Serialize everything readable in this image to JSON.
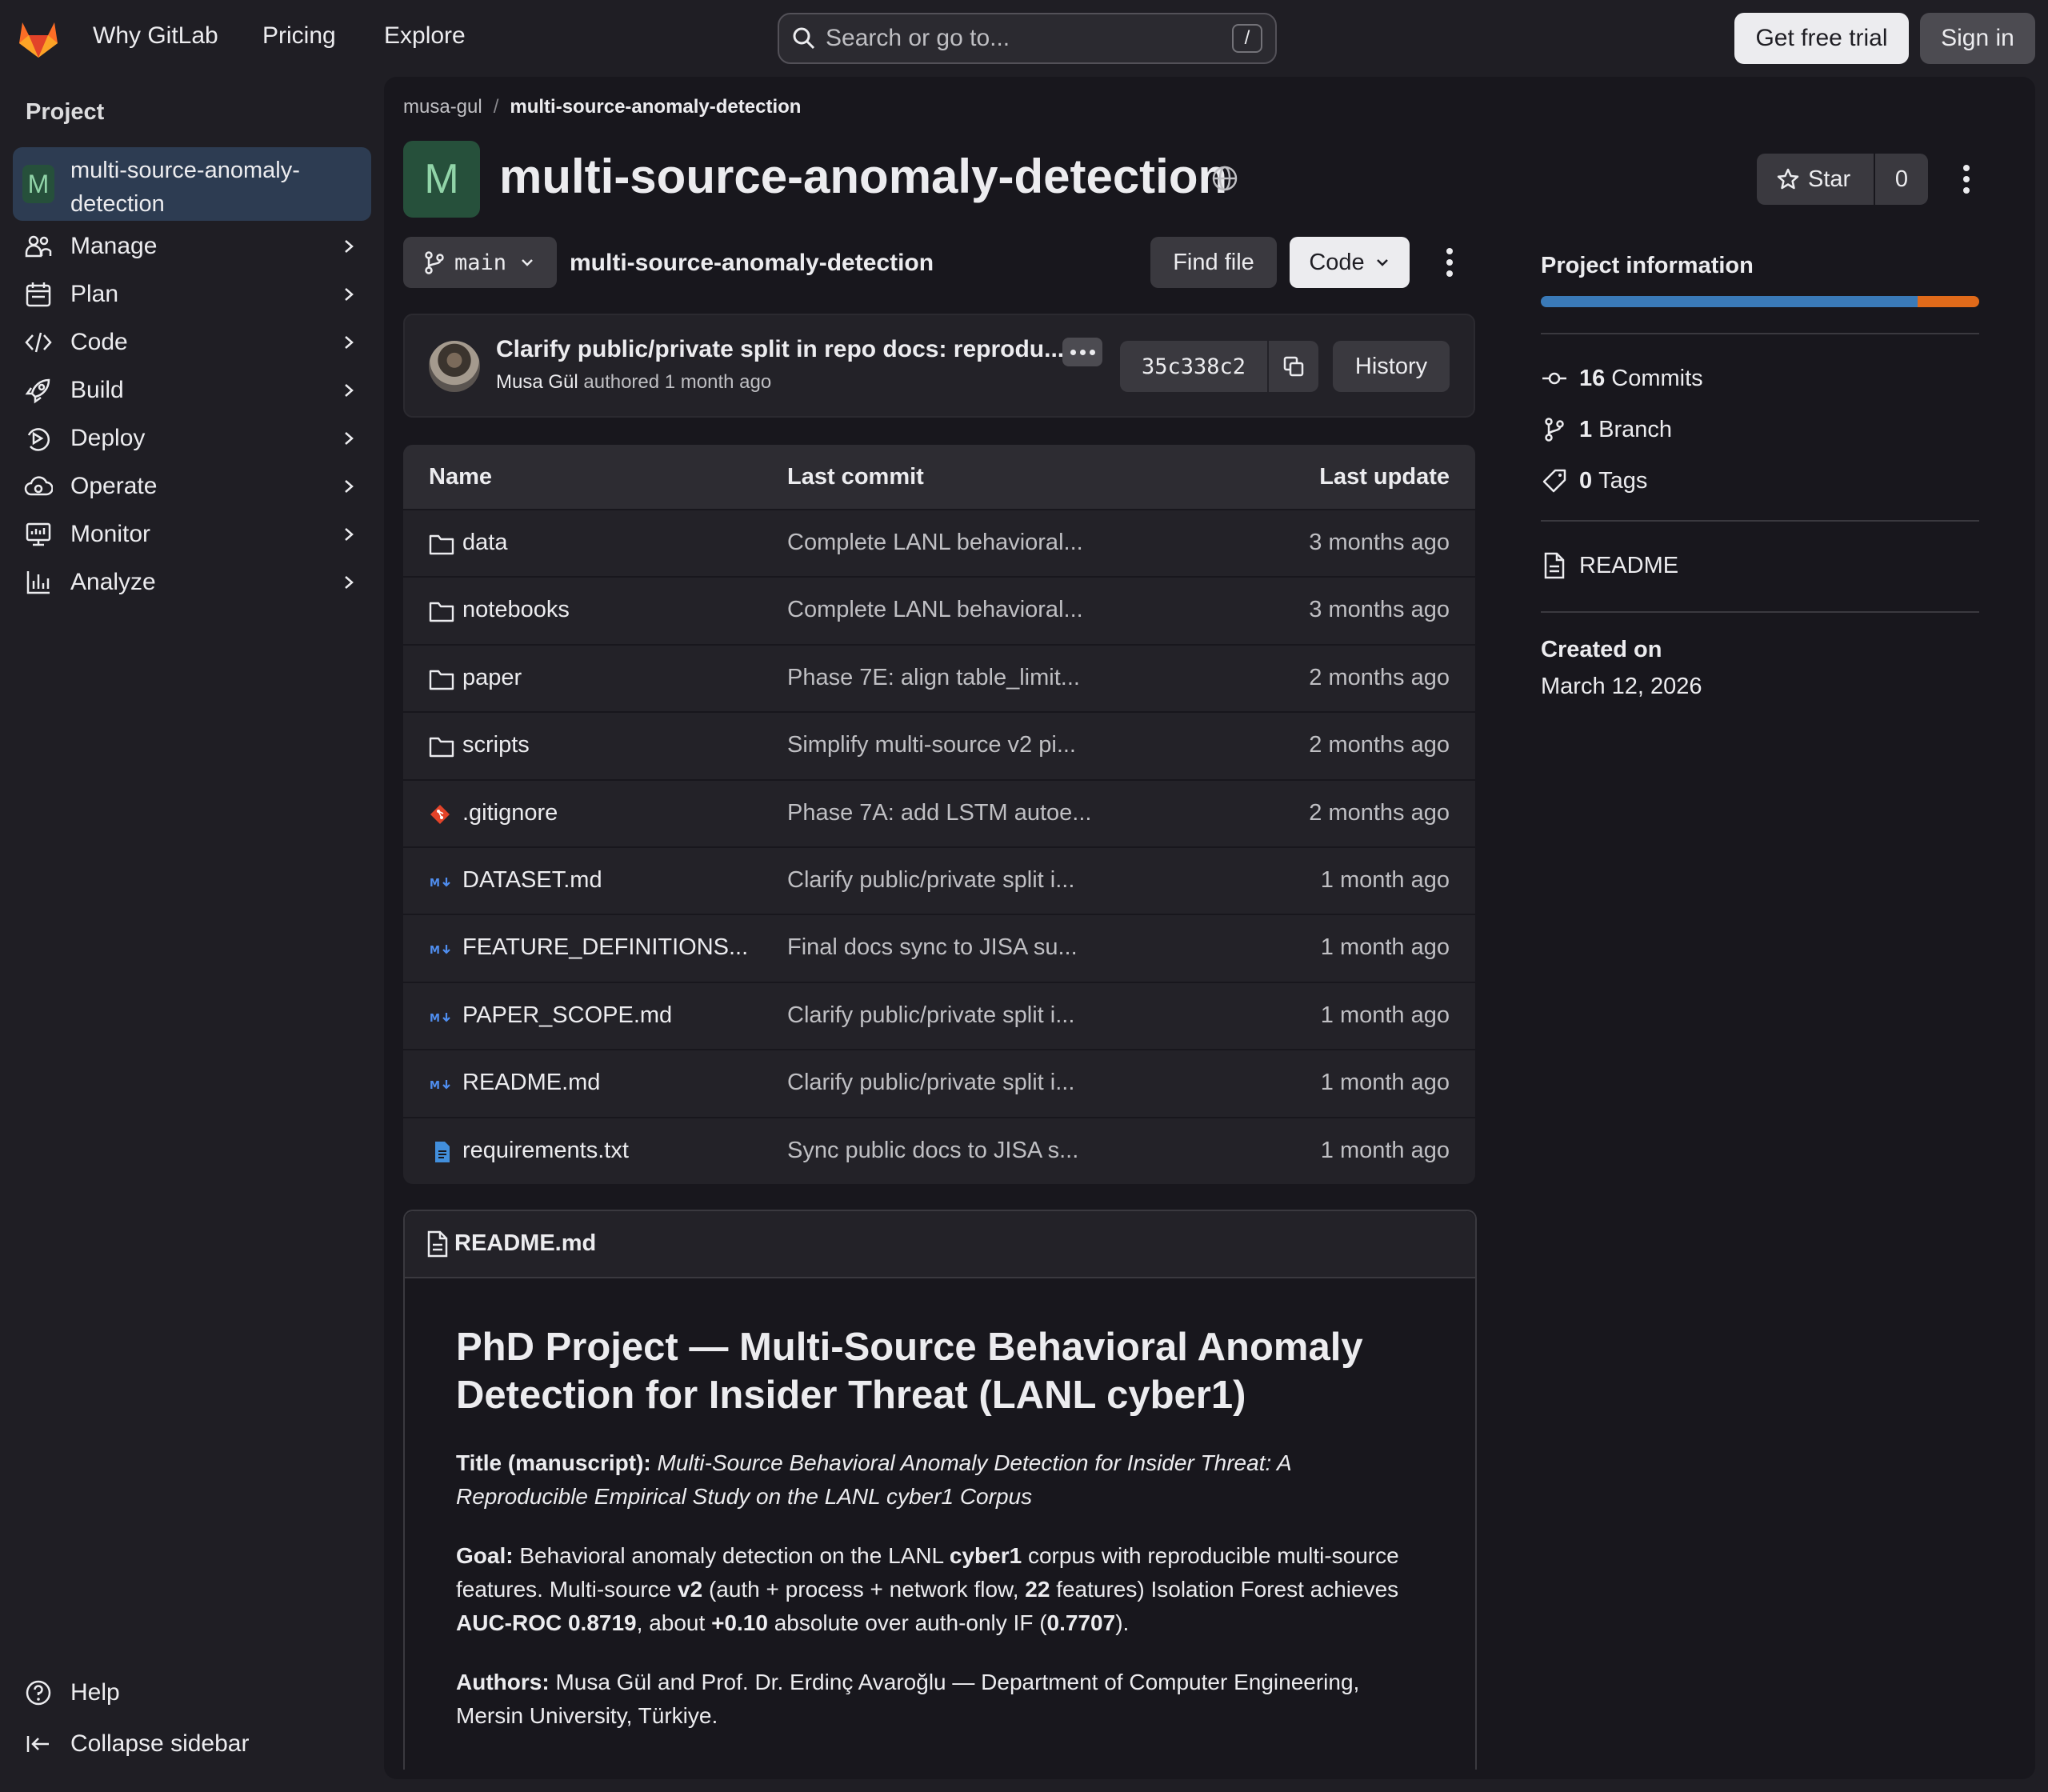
{
  "topbar": {
    "nav": [
      "Why GitLab",
      "Pricing",
      "Explore"
    ],
    "search_placeholder": "Search or go to...",
    "search_shortcut": "/",
    "trial_label": "Get free trial",
    "signin_label": "Sign in"
  },
  "sidebar": {
    "title": "Project",
    "project_initial": "M",
    "project_name": "multi-source-anomaly-detection",
    "items": [
      {
        "label": "Manage",
        "icon": "users-icon"
      },
      {
        "label": "Plan",
        "icon": "calendar-icon"
      },
      {
        "label": "Code",
        "icon": "code-icon"
      },
      {
        "label": "Build",
        "icon": "rocket-icon"
      },
      {
        "label": "Deploy",
        "icon": "deploy-icon"
      },
      {
        "label": "Operate",
        "icon": "cloud-gear-icon"
      },
      {
        "label": "Monitor",
        "icon": "monitor-icon"
      },
      {
        "label": "Analyze",
        "icon": "chart-icon"
      }
    ],
    "help_label": "Help",
    "collapse_label": "Collapse sidebar"
  },
  "breadcrumb": {
    "owner": "musa-gul",
    "repo": "multi-source-anomaly-detection"
  },
  "repo": {
    "initial": "M",
    "title": "multi-source-anomaly-detection",
    "star_label": "Star",
    "star_count": "0",
    "branch": "main",
    "path": "multi-source-anomaly-detection",
    "find_file_label": "Find file",
    "code_label": "Code"
  },
  "commit": {
    "message": "Clarify public/private split in repo docs: reprodu...",
    "author": "Musa Gül",
    "meta": "authored 1 month ago",
    "sha": "35c338c2",
    "history_label": "History"
  },
  "files": {
    "headers": {
      "name": "Name",
      "commit": "Last commit",
      "update": "Last update"
    },
    "rows": [
      {
        "name": "data",
        "type": "folder",
        "commit": "Complete LANL behavioral...",
        "date": "3 months ago"
      },
      {
        "name": "notebooks",
        "type": "folder",
        "commit": "Complete LANL behavioral...",
        "date": "3 months ago"
      },
      {
        "name": "paper",
        "type": "folder",
        "commit": "Phase 7E: align table_limit...",
        "date": "2 months ago"
      },
      {
        "name": "scripts",
        "type": "folder",
        "commit": "Simplify multi-source v2 pi...",
        "date": "2 months ago"
      },
      {
        "name": ".gitignore",
        "type": "git",
        "commit": "Phase 7A: add LSTM autoe...",
        "date": "2 months ago"
      },
      {
        "name": "DATASET.md",
        "type": "md",
        "commit": "Clarify public/private split i...",
        "date": "1 month ago"
      },
      {
        "name": "FEATURE_DEFINITIONS...",
        "type": "md",
        "commit": "Final docs sync to JISA su...",
        "date": "1 month ago"
      },
      {
        "name": "PAPER_SCOPE.md",
        "type": "md",
        "commit": "Clarify public/private split i...",
        "date": "1 month ago"
      },
      {
        "name": "README.md",
        "type": "md",
        "commit": "Clarify public/private split i...",
        "date": "1 month ago"
      },
      {
        "name": "requirements.txt",
        "type": "txt",
        "commit": "Sync public docs to JISA s...",
        "date": "1 month ago"
      }
    ]
  },
  "readme": {
    "file_label": "README.md",
    "h1": "PhD Project — Multi-Source Behavioral Anomaly Detection for Insider Threat (LANL cyber1)",
    "title_label": "Title (manuscript):",
    "title_text": "Multi-Source Behavioral Anomaly Detection for Insider Threat: A Reproducible Empirical Study on the LANL cyber1 Corpus",
    "goal_label": "Goal:",
    "goal_1": "Behavioral anomaly detection on the LANL",
    "goal_b1": "cyber1",
    "goal_2": "corpus with reproducible multi-source features. Multi-source",
    "goal_b2": "v2",
    "goal_3": "(auth + process + network flow,",
    "goal_b3": "22",
    "goal_4": "features) Isolation Forest achieves",
    "goal_b4": "AUC-ROC 0.8719",
    "goal_5": ", about",
    "goal_b5": "+0.10",
    "goal_6": "absolute over auth-only IF (",
    "goal_b6": "0.7707",
    "goal_7": ").",
    "authors_label": "Authors:",
    "authors_text": "Musa Gül and Prof. Dr. Erdinç Avaroğlu — Department of Computer Engineering, Mersin University, Türkiye."
  },
  "info": {
    "title": "Project information",
    "language_share": [
      0.86,
      0.14
    ],
    "language_colors": [
      "#3a7ab8",
      "#e06a1a"
    ],
    "commits_count": "16",
    "commits_label": "Commits",
    "branch_count": "1",
    "branch_label": "Branch",
    "tags_count": "0",
    "tags_label": "Tags",
    "readme_label": "README",
    "created_label": "Created on",
    "created_value": "March 12, 2026"
  }
}
